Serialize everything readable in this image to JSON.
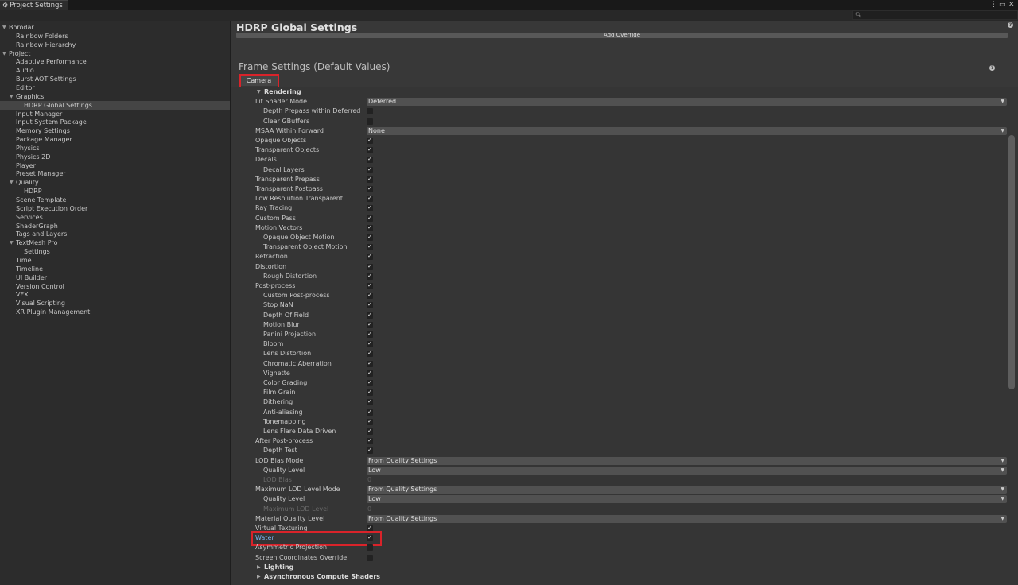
{
  "window": {
    "tab_title": "Project Settings"
  },
  "sidebar": {
    "items": [
      {
        "label": "Borodar",
        "depth": 0,
        "expanded": true
      },
      {
        "label": "Rainbow Folders",
        "depth": 1
      },
      {
        "label": "Rainbow Hierarchy",
        "depth": 1
      },
      {
        "label": "Project",
        "depth": 0,
        "expanded": true
      },
      {
        "label": "Adaptive Performance",
        "depth": 1
      },
      {
        "label": "Audio",
        "depth": 1
      },
      {
        "label": "Burst AOT Settings",
        "depth": 1
      },
      {
        "label": "Editor",
        "depth": 1
      },
      {
        "label": "Graphics",
        "depth": 1,
        "expanded": true
      },
      {
        "label": "HDRP Global Settings",
        "depth": 2,
        "selected": true
      },
      {
        "label": "Input Manager",
        "depth": 1
      },
      {
        "label": "Input System Package",
        "depth": 1
      },
      {
        "label": "Memory Settings",
        "depth": 1
      },
      {
        "label": "Package Manager",
        "depth": 1
      },
      {
        "label": "Physics",
        "depth": 1
      },
      {
        "label": "Physics 2D",
        "depth": 1
      },
      {
        "label": "Player",
        "depth": 1
      },
      {
        "label": "Preset Manager",
        "depth": 1
      },
      {
        "label": "Quality",
        "depth": 1,
        "expanded": true
      },
      {
        "label": "HDRP",
        "depth": 2
      },
      {
        "label": "Scene Template",
        "depth": 1
      },
      {
        "label": "Script Execution Order",
        "depth": 1
      },
      {
        "label": "Services",
        "depth": 1
      },
      {
        "label": "ShaderGraph",
        "depth": 1
      },
      {
        "label": "Tags and Layers",
        "depth": 1
      },
      {
        "label": "TextMesh Pro",
        "depth": 1,
        "expanded": true
      },
      {
        "label": "Settings",
        "depth": 2
      },
      {
        "label": "Time",
        "depth": 1
      },
      {
        "label": "Timeline",
        "depth": 1
      },
      {
        "label": "UI Builder",
        "depth": 1
      },
      {
        "label": "Version Control",
        "depth": 1
      },
      {
        "label": "VFX",
        "depth": 1
      },
      {
        "label": "Visual Scripting",
        "depth": 1
      },
      {
        "label": "XR Plugin Management",
        "depth": 1
      }
    ]
  },
  "main": {
    "title": "HDRP Global Settings",
    "add_override_label": "Add Override",
    "frame_settings_title": "Frame Settings (Default Values)",
    "camera_tab": "Camera",
    "rows": [
      {
        "label": "Rendering",
        "indent": 1,
        "type": "foldout",
        "expanded": true
      },
      {
        "label": "Lit Shader Mode",
        "indent": 0,
        "type": "dropdown",
        "value": "Deferred"
      },
      {
        "label": "Depth Prepass within Deferred",
        "indent": 1,
        "type": "checkbox",
        "checked": false
      },
      {
        "label": "Clear GBuffers",
        "indent": 1,
        "type": "checkbox",
        "checked": false
      },
      {
        "label": "MSAA Within Forward",
        "indent": 0,
        "type": "dropdown",
        "value": "None"
      },
      {
        "label": "Opaque Objects",
        "indent": 0,
        "type": "checkbox",
        "checked": true
      },
      {
        "label": "Transparent Objects",
        "indent": 0,
        "type": "checkbox",
        "checked": true
      },
      {
        "label": "Decals",
        "indent": 0,
        "type": "checkbox",
        "checked": true
      },
      {
        "label": "Decal Layers",
        "indent": 1,
        "type": "checkbox",
        "checked": true
      },
      {
        "label": "Transparent Prepass",
        "indent": 0,
        "type": "checkbox",
        "checked": true
      },
      {
        "label": "Transparent Postpass",
        "indent": 0,
        "type": "checkbox",
        "checked": true
      },
      {
        "label": "Low Resolution Transparent",
        "indent": 0,
        "type": "checkbox",
        "checked": true
      },
      {
        "label": "Ray Tracing",
        "indent": 0,
        "type": "checkbox",
        "checked": true
      },
      {
        "label": "Custom Pass",
        "indent": 0,
        "type": "checkbox",
        "checked": true
      },
      {
        "label": "Motion Vectors",
        "indent": 0,
        "type": "checkbox",
        "checked": true
      },
      {
        "label": "Opaque Object Motion",
        "indent": 1,
        "type": "checkbox",
        "checked": true
      },
      {
        "label": "Transparent Object Motion",
        "indent": 1,
        "type": "checkbox",
        "checked": true
      },
      {
        "label": "Refraction",
        "indent": 0,
        "type": "checkbox",
        "checked": true
      },
      {
        "label": "Distortion",
        "indent": 0,
        "type": "checkbox",
        "checked": true
      },
      {
        "label": "Rough Distortion",
        "indent": 1,
        "type": "checkbox",
        "checked": true
      },
      {
        "label": "Post-process",
        "indent": 0,
        "type": "checkbox",
        "checked": true
      },
      {
        "label": "Custom Post-process",
        "indent": 1,
        "type": "checkbox",
        "checked": true
      },
      {
        "label": "Stop NaN",
        "indent": 1,
        "type": "checkbox",
        "checked": true
      },
      {
        "label": "Depth Of Field",
        "indent": 1,
        "type": "checkbox",
        "checked": true
      },
      {
        "label": "Motion Blur",
        "indent": 1,
        "type": "checkbox",
        "checked": true
      },
      {
        "label": "Panini Projection",
        "indent": 1,
        "type": "checkbox",
        "checked": true
      },
      {
        "label": "Bloom",
        "indent": 1,
        "type": "checkbox",
        "checked": true
      },
      {
        "label": "Lens Distortion",
        "indent": 1,
        "type": "checkbox",
        "checked": true
      },
      {
        "label": "Chromatic Aberration",
        "indent": 1,
        "type": "checkbox",
        "checked": true
      },
      {
        "label": "Vignette",
        "indent": 1,
        "type": "checkbox",
        "checked": true
      },
      {
        "label": "Color Grading",
        "indent": 1,
        "type": "checkbox",
        "checked": true
      },
      {
        "label": "Film Grain",
        "indent": 1,
        "type": "checkbox",
        "checked": true
      },
      {
        "label": "Dithering",
        "indent": 1,
        "type": "checkbox",
        "checked": true
      },
      {
        "label": "Anti-aliasing",
        "indent": 1,
        "type": "checkbox",
        "checked": true
      },
      {
        "label": "Tonemapping",
        "indent": 1,
        "type": "checkbox",
        "checked": true
      },
      {
        "label": "Lens Flare Data Driven",
        "indent": 1,
        "type": "checkbox",
        "checked": true
      },
      {
        "label": "After Post-process",
        "indent": 0,
        "type": "checkbox",
        "checked": true
      },
      {
        "label": "Depth Test",
        "indent": 1,
        "type": "checkbox",
        "checked": true
      },
      {
        "label": "LOD Bias Mode",
        "indent": 0,
        "type": "dropdown",
        "value": "From Quality Settings"
      },
      {
        "label": "Quality Level",
        "indent": 1,
        "type": "dropdown",
        "value": "Low"
      },
      {
        "label": "LOD Bias",
        "indent": 1,
        "type": "number",
        "value": "0",
        "disabled": true
      },
      {
        "label": "Maximum LOD Level Mode",
        "indent": 0,
        "type": "dropdown",
        "value": "From Quality Settings"
      },
      {
        "label": "Quality Level",
        "indent": 1,
        "type": "dropdown",
        "value": "Low"
      },
      {
        "label": "Maximum LOD Level",
        "indent": 1,
        "type": "number",
        "value": "0",
        "disabled": true
      },
      {
        "label": "Material Quality Level",
        "indent": 0,
        "type": "dropdown",
        "value": "From Quality Settings"
      },
      {
        "label": "Virtual Texturing",
        "indent": 0,
        "type": "checkbox",
        "checked": true
      },
      {
        "label": "Water",
        "indent": 0,
        "type": "checkbox",
        "checked": true,
        "highlight": true
      },
      {
        "label": "Asymmetric Projection",
        "indent": 0,
        "type": "checkbox",
        "checked": false
      },
      {
        "label": "Screen Coordinates Override",
        "indent": 0,
        "type": "checkbox",
        "checked": false
      },
      {
        "label": "Lighting",
        "indent": 1,
        "type": "foldout",
        "expanded": false
      },
      {
        "label": "Asynchronous Compute Shaders",
        "indent": 1,
        "type": "foldout",
        "expanded": false
      }
    ]
  },
  "colors": {
    "highlight": "#d9232a",
    "link": "#7ab4ee",
    "accent": "#454545"
  }
}
